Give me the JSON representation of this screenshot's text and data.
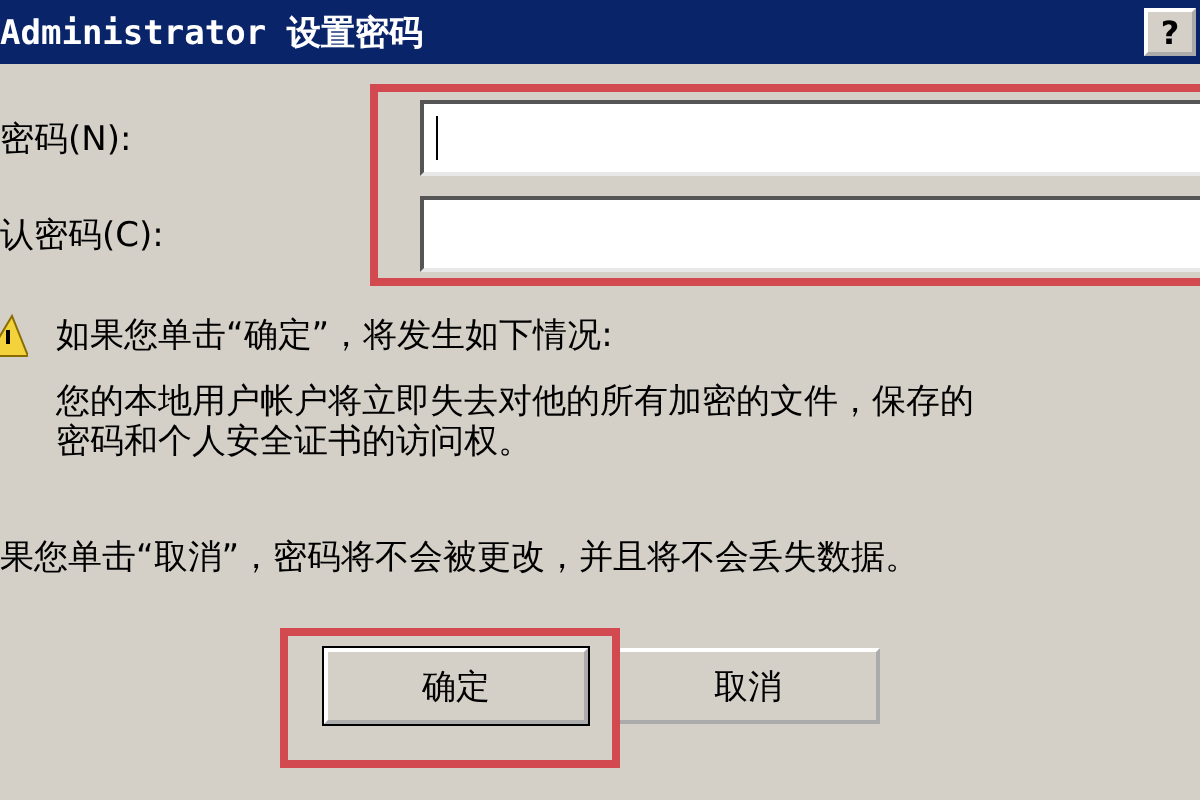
{
  "window": {
    "title": "Administrator 设置密码",
    "help_button": "?"
  },
  "fields": [
    {
      "label": "密码(N):",
      "focused": true
    },
    {
      "label": "认密码(C):",
      "focused": false
    }
  ],
  "warning": {
    "heading": "如果您单击“确定”，将发生如下情况:",
    "body_lines": [
      "您的本地用户帐户将立即失去对他的所有加密的文件，保存的",
      "密码和个人安全证书的访问权。"
    ]
  },
  "cancel_note": "果您单击“取消”，密码将不会被更改，并且将不会丢失数据。",
  "buttons": [
    {
      "label": "确定",
      "default": true
    },
    {
      "label": "取消",
      "default": false
    }
  ]
}
